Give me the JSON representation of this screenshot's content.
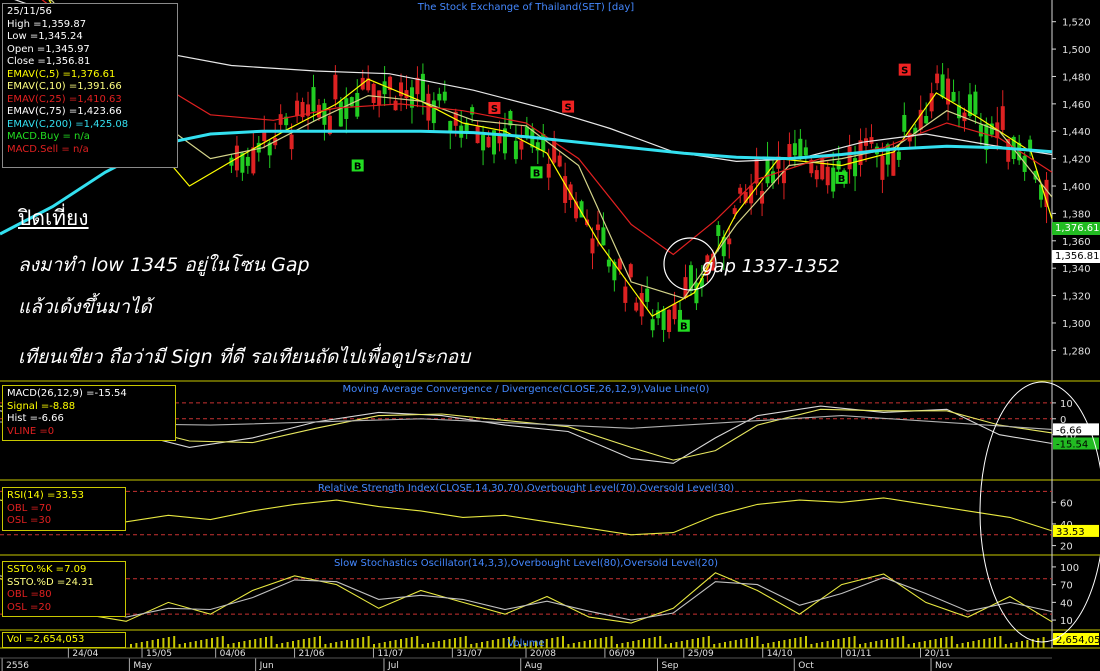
{
  "chart_data": [
    {
      "type": "line",
      "title": "The Stock Exchange of Thailand(SET) [day]",
      "xlabel": "",
      "ylabel": "",
      "x_ticks": [
        "24/04",
        "15/05",
        "04/06",
        "21/06",
        "11/07",
        "31/07",
        "20/08",
        "06/09",
        "25/09",
        "14/10",
        "01/11",
        "20/11"
      ],
      "month_labels": [
        "2556",
        "May",
        "Jun",
        "Jul",
        "Aug",
        "Sep",
        "Oct",
        "Nov"
      ],
      "y_ticks": [
        1280,
        1300,
        1320,
        1340,
        1360,
        1380,
        1400,
        1420,
        1440,
        1460,
        1480,
        1500,
        1520
      ],
      "ylim": [
        1262,
        1530
      ],
      "series": [
        {
          "name": "EMAV(C,5)",
          "color": "#ffff00",
          "x": [
            0,
            4,
            8,
            13,
            18,
            22,
            27,
            32,
            35,
            40,
            44,
            48,
            52,
            57,
            62,
            66,
            70,
            74,
            80,
            85,
            89,
            93,
            98,
            100
          ],
          "y": [
            1560,
            1545,
            1490,
            1445,
            1400,
            1418,
            1440,
            1460,
            1478,
            1462,
            1446,
            1440,
            1424,
            1358,
            1305,
            1322,
            1380,
            1420,
            1415,
            1425,
            1468,
            1450,
            1425,
            1376
          ]
        },
        {
          "name": "EMAV(C,10)",
          "color": "#d4d48a",
          "x": [
            0,
            5,
            10,
            15,
            20,
            25,
            30,
            35,
            40,
            45,
            50,
            55,
            60,
            65,
            70,
            75,
            80,
            85,
            90,
            95,
            100
          ],
          "y": [
            1555,
            1535,
            1485,
            1448,
            1420,
            1428,
            1448,
            1466,
            1462,
            1448,
            1444,
            1415,
            1330,
            1318,
            1372,
            1415,
            1420,
            1428,
            1455,
            1440,
            1392
          ]
        },
        {
          "name": "EMAV(C,25)",
          "color": "#e02020",
          "x": [
            0,
            8,
            14,
            20,
            26,
            32,
            38,
            44,
            50,
            55,
            60,
            64,
            68,
            72,
            78,
            84,
            90,
            95,
            100
          ],
          "y": [
            1560,
            1512,
            1480,
            1452,
            1448,
            1457,
            1460,
            1455,
            1446,
            1420,
            1372,
            1350,
            1375,
            1405,
            1420,
            1428,
            1446,
            1435,
            1410
          ]
        },
        {
          "name": "EMAV(C,75)",
          "color": "#e8e8e8",
          "x": [
            0,
            8,
            15,
            22,
            30,
            37,
            45,
            52,
            58,
            64,
            70,
            76,
            82,
            88,
            94,
            100
          ],
          "y": [
            1540,
            1518,
            1498,
            1488,
            1484,
            1482,
            1470,
            1456,
            1442,
            1425,
            1418,
            1420,
            1432,
            1438,
            1430,
            1423
          ]
        },
        {
          "name": "EMAV(C,200)",
          "color": "#33e0f0",
          "x": [
            0,
            5,
            10,
            15,
            20,
            25,
            30,
            35,
            40,
            45,
            50,
            55,
            60,
            65,
            70,
            75,
            80,
            85,
            90,
            95,
            100
          ],
          "y": [
            1365,
            1385,
            1410,
            1430,
            1438,
            1440,
            1440,
            1440,
            1440,
            1439,
            1436,
            1432,
            1428,
            1424,
            1421,
            1420,
            1423,
            1427,
            1429,
            1428,
            1425
          ]
        }
      ]
    },
    {
      "type": "line",
      "title": "Moving Average Convergence / Divergence(CLOSE,26,12,9),Value Line(0)",
      "y_ticks": [
        10,
        0,
        -10
      ],
      "ylim": [
        -36,
        20
      ],
      "series": [
        {
          "name": "MACD(26,12,9)",
          "color": "#d8d8d8",
          "x": [
            0,
            6,
            12,
            18,
            24,
            30,
            36,
            42,
            48,
            54,
            60,
            64,
            68,
            72,
            78,
            84,
            90,
            95,
            100
          ],
          "y": [
            5,
            -2,
            -8,
            -18,
            -12,
            -2,
            4,
            2,
            -4,
            -8,
            -25,
            -28,
            -12,
            2,
            8,
            4,
            6,
            -10,
            -15.54
          ]
        },
        {
          "name": "Signal",
          "color": "#e8e860",
          "x": [
            0,
            6,
            12,
            18,
            24,
            30,
            36,
            42,
            48,
            54,
            60,
            64,
            68,
            72,
            78,
            84,
            90,
            95,
            100
          ],
          "y": [
            8,
            2,
            -4,
            -14,
            -15,
            -6,
            2,
            3,
            -1,
            -5,
            -18,
            -26,
            -20,
            -4,
            6,
            5,
            5,
            -4,
            -8.88
          ]
        },
        {
          "name": "Hist",
          "color": "#b0b0b0",
          "x": [
            0,
            20,
            40,
            60,
            80,
            100
          ],
          "y": [
            -2,
            -4,
            0,
            -6,
            2,
            -6.66
          ]
        }
      ],
      "value_labels": [
        "-6.66",
        "-15.54"
      ]
    },
    {
      "type": "line",
      "title": "Relative Strength Index(CLOSE,14,30,70),Overbought Level(70),Oversold Level(30)",
      "y_ticks": [
        60,
        40,
        20
      ],
      "ylim": [
        15,
        75
      ],
      "series": [
        {
          "name": "RSI(14)",
          "color": "#e8e840",
          "x": [
            0,
            4,
            8,
            12,
            16,
            20,
            24,
            28,
            32,
            36,
            40,
            44,
            48,
            52,
            56,
            60,
            64,
            68,
            72,
            76,
            80,
            84,
            88,
            92,
            96,
            100
          ],
          "y": [
            62,
            55,
            50,
            42,
            48,
            44,
            52,
            58,
            62,
            56,
            52,
            46,
            48,
            42,
            36,
            30,
            32,
            48,
            58,
            62,
            60,
            64,
            58,
            52,
            46,
            33.53
          ]
        }
      ],
      "value_labels": [
        "33.53"
      ]
    },
    {
      "type": "line",
      "title": "Slow Stochastics Oscillator(14,3,3),Overbought Level(80),Oversold Level(20)",
      "y_ticks": [
        100,
        70,
        40,
        10
      ],
      "ylim": [
        0,
        110
      ],
      "series": [
        {
          "name": "SSTO.%K",
          "color": "#e8e840",
          "x": [
            0,
            4,
            8,
            12,
            16,
            20,
            24,
            28,
            32,
            36,
            40,
            44,
            48,
            52,
            56,
            60,
            64,
            68,
            72,
            76,
            80,
            84,
            88,
            92,
            96,
            100
          ],
          "y": [
            80,
            60,
            20,
            8,
            40,
            20,
            60,
            85,
            70,
            30,
            60,
            40,
            20,
            50,
            15,
            5,
            30,
            90,
            60,
            20,
            70,
            88,
            40,
            15,
            50,
            7.09
          ]
        },
        {
          "name": "SSTO.%D",
          "color": "#c0c0c0",
          "x": [
            0,
            4,
            8,
            12,
            16,
            20,
            24,
            28,
            32,
            36,
            40,
            44,
            48,
            52,
            56,
            60,
            64,
            68,
            72,
            76,
            80,
            84,
            88,
            92,
            96,
            100
          ],
          "y": [
            85,
            70,
            35,
            15,
            30,
            28,
            48,
            78,
            75,
            45,
            52,
            45,
            28,
            42,
            25,
            10,
            22,
            75,
            70,
            35,
            55,
            82,
            55,
            25,
            40,
            24.31
          ]
        }
      ]
    },
    {
      "type": "bar",
      "title": "Volume",
      "value_labels": [
        "2,654,053"
      ]
    }
  ],
  "info_main": {
    "date": "25/11/56",
    "high": "High  =1,359.87",
    "low": "Low  =1,345.24",
    "open": "Open  =1,345.97",
    "close": "Close  =1,356.81",
    "ema5": "EMAV(C,5)  =1,376.61",
    "ema10": "EMAV(C,10)  =1,391.66",
    "ema25": "EMAV(C,25)  =1,410.63",
    "ema75": "EMAV(C,75)  =1,423.66",
    "ema200": "EMAV(C,200)  =1,425.08",
    "macd_buy": "MACD.Buy  = n/a",
    "macd_sell": "MACD.Sell  = n/a"
  },
  "info_macd": {
    "macd": "MACD(26,12,9)  =-15.54",
    "signal": "Signal  =-8.88",
    "hist": "Hist  =-6.66",
    "vline": "VLINE  =0"
  },
  "info_rsi": {
    "rsi": "RSI(14)  =33.53",
    "obl": "OBL  =70",
    "osl": "OSL  =30"
  },
  "info_ssto": {
    "k": "SSTO.%K  =7.09",
    "d": "SSTO.%D  =24.31",
    "obl": "OBL  =80",
    "osl": "OSL  =20"
  },
  "info_vol": {
    "vol": "Vol  =2,654,053"
  },
  "price_tags": [
    "1,376.61",
    "1,356.81"
  ],
  "annotations": {
    "title": "ปิดเที่ยง",
    "line1": "ลงมาทำ low 1345 อยู่ในโซน Gap",
    "line2": "แล้วเด้งขึ้นมาได้",
    "line3": "เทียนเขียว ถือว่ามี Sign ที่ดี รอเทียนถัดไปเพื่อดูประกอบ",
    "gap": "gap 1337-1352"
  },
  "signals": [
    {
      "label": "B",
      "color": "#22dd22"
    },
    {
      "label": "B",
      "color": "#22dd22"
    },
    {
      "label": "B",
      "color": "#22dd22"
    },
    {
      "label": "B",
      "color": "#22dd22"
    },
    {
      "label": "S",
      "color": "#ee2222"
    },
    {
      "label": "S",
      "color": "#ee2222"
    },
    {
      "label": "S",
      "color": "#ee2222"
    }
  ],
  "colors": {
    "up": "#22cc22",
    "down": "#dd2222",
    "grid": "#c83232",
    "axis": "#ffff00"
  }
}
